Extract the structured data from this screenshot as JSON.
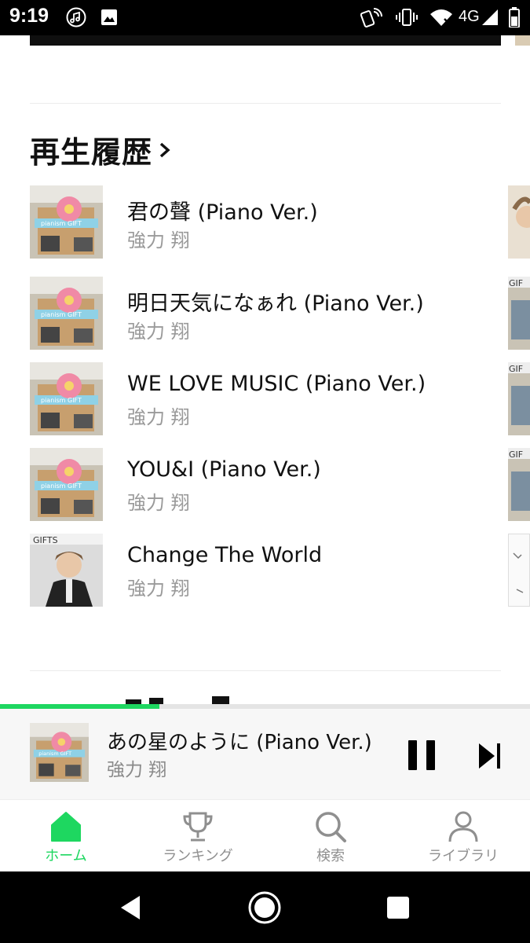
{
  "status_bar": {
    "time": "9:19",
    "network": "4G"
  },
  "section": {
    "title": "再生履歴"
  },
  "tracks": [
    {
      "title": "君の聲 (Piano Ver.)",
      "artist": "強力 翔",
      "art": "pianism-gift"
    },
    {
      "title": "明日天気になぁれ (Piano Ver.)",
      "artist": "強力 翔",
      "art": "pianism-gift"
    },
    {
      "title": "WE LOVE MUSIC (Piano Ver.)",
      "artist": "強力 翔",
      "art": "pianism-gift"
    },
    {
      "title": "YOU&I (Piano Ver.)",
      "artist": "強力 翔",
      "art": "pianism-gift"
    },
    {
      "title": "Change The World",
      "artist": "強力 翔",
      "art": "gifts-portrait"
    }
  ],
  "now_playing": {
    "title": "あの星のように (Piano Ver.)",
    "artist": "強力 翔",
    "progress": 0.3
  },
  "bottom_nav": [
    {
      "label": "ホーム",
      "icon": "home-icon",
      "active": true
    },
    {
      "label": "ランキング",
      "icon": "trophy-icon",
      "active": false
    },
    {
      "label": "検索",
      "icon": "search-icon",
      "active": false
    },
    {
      "label": "ライブラリ",
      "icon": "person-icon",
      "active": false
    }
  ],
  "colors": {
    "accent": "#1ed760",
    "muted_text": "#9a9a9a"
  }
}
